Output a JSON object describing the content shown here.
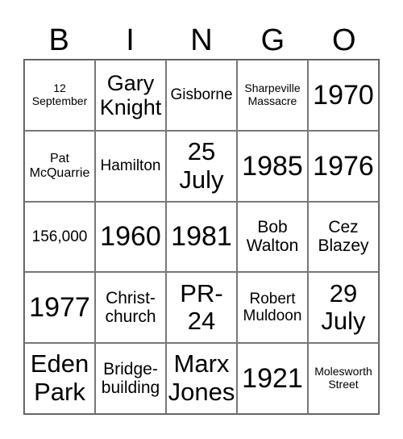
{
  "header": [
    "B",
    "I",
    "N",
    "G",
    "O"
  ],
  "cells": [
    [
      "12\nSeptember",
      "Gary\nKnight",
      "Gisborne",
      "Sharpeville\nMassacre",
      "1970"
    ],
    [
      "Pat\nMcQuarrie",
      "Hamilton",
      "25\nJuly",
      "1985",
      "1976"
    ],
    [
      "156,000",
      "1960",
      "1981",
      "Bob\nWalton",
      "Cez\nBlazey"
    ],
    [
      "1977",
      "Christ-\nchurch",
      "PR-\n24",
      "Robert\nMuldoon",
      "29\nJuly"
    ],
    [
      "Eden\nPark",
      "Bridge-\nbuilding",
      "Marx\nJones",
      "1921",
      "Molesworth\nStreet"
    ]
  ]
}
